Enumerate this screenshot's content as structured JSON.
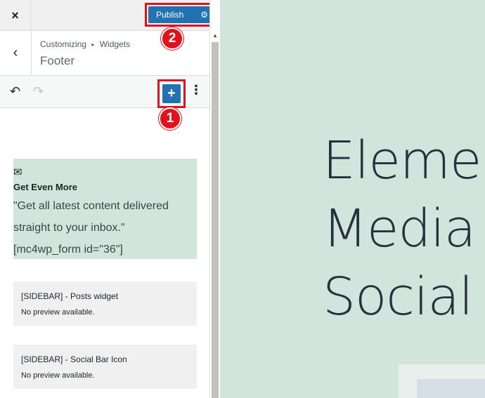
{
  "topbar": {
    "close_icon": "×",
    "publish_label": "Publish",
    "publish_gear_icon": "⚙"
  },
  "annotations": {
    "badge_1": "1",
    "badge_2": "2"
  },
  "section": {
    "back_icon": "‹",
    "breadcrumb_parent": "Customizing",
    "breadcrumb_separator": "▸",
    "breadcrumb_child": "Widgets",
    "title": "Footer"
  },
  "toolbar": {
    "undo_icon": "↶",
    "redo_icon": "↷",
    "add_icon": "+",
    "more_icon": "⋮"
  },
  "email_widget": {
    "envelope_icon": "✉",
    "heading": "Get Even More",
    "quote": "\"Get all latest content delivered straight to your inbox.\"",
    "shortcode": "[mc4wp_form id=\"36\"]"
  },
  "previews": [
    {
      "title": "[SIDEBAR] - Posts widget",
      "note": "No preview available."
    },
    {
      "title": "[SIDEBAR] - Social Bar Icon",
      "note": "No preview available."
    }
  ],
  "site_preview": {
    "hero_lines": [
      "Elemen",
      "Media",
      "Social"
    ]
  },
  "colors": {
    "accent_blue": "#2271b1",
    "annotation_red": "#e0121b",
    "preview_bg": "#d2e5dd"
  }
}
